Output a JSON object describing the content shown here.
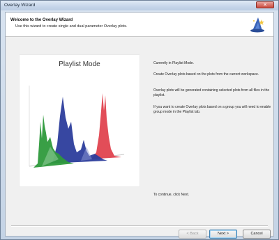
{
  "window": {
    "title": "Overlay Wizard",
    "close_glyph": "✕"
  },
  "header": {
    "title": "Welcome to the Overlay Wizard",
    "subtitle": "Use this wizard to create single and dual parameter Overlay plots.",
    "icon": "wizard-hat-icon"
  },
  "image_panel": {
    "title": "Playlist Mode",
    "colors": {
      "green": "#2e9a3c",
      "blue": "#2c3d9c",
      "red": "#e0434f"
    }
  },
  "info": {
    "line1": "Currently in Playlist Mode.",
    "line2": "Create Overlay plots based on the plots from the current workspace.",
    "line3": "Overlay plots will be generated containing selected plots from all files in the playlist.",
    "line4": "If you want to create Overlay plots based on a group you will need to enable group mode in the Playlist tab.",
    "continue": "To continue, click Next."
  },
  "buttons": {
    "back": "< Back",
    "next": "Next >",
    "cancel": "Cancel"
  }
}
